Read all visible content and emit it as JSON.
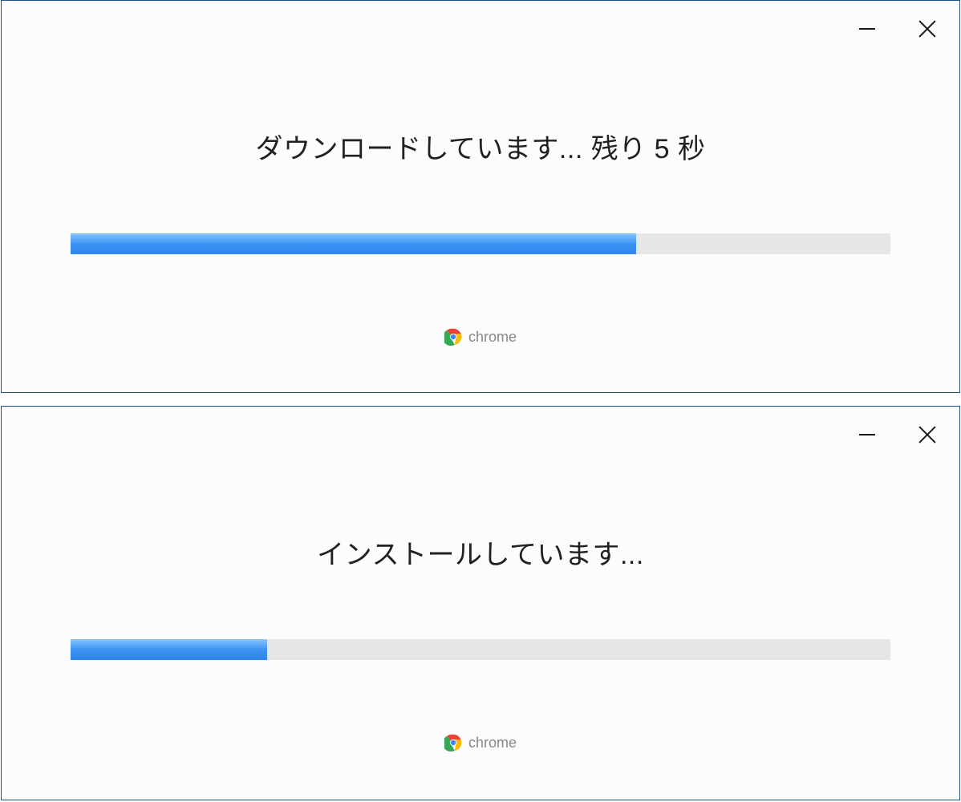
{
  "window1": {
    "status": "ダウンロードしています... 残り 5 秒",
    "progress_percent": 69,
    "brand_label": "chrome"
  },
  "window2": {
    "status": "インストールしています...",
    "progress_percent": 24,
    "brand_label": "chrome"
  }
}
